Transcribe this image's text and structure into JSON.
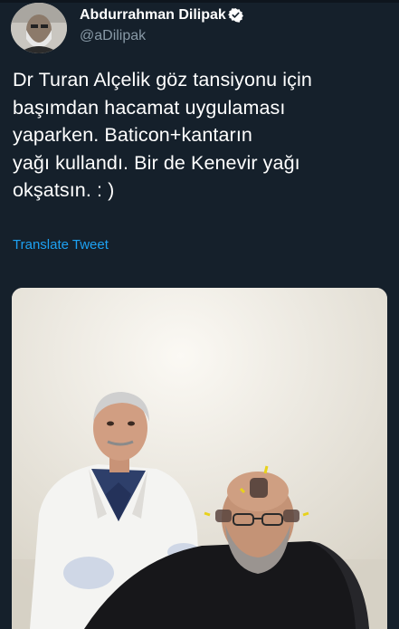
{
  "tweet": {
    "author_name": "Abdurrahman Dilipak",
    "author_handle": "@aDilipak",
    "text_lines": [
      "Dr Turan Alçelik göz tansiyonu için",
      "başımdan hacamat uygulaması",
      "yaparken. Baticon+kantarın",
      "yağı kullandı. Bir de Kenevir yağı",
      "okşatsın. : )"
    ],
    "translate_label": "Translate Tweet"
  },
  "icons": {
    "verified": "verified-badge-icon",
    "avatar": "profile-photo"
  },
  "colors": {
    "background": "#15202b",
    "text": "#ffffff",
    "secondary_text": "#8899a6",
    "link": "#1da1f2"
  }
}
